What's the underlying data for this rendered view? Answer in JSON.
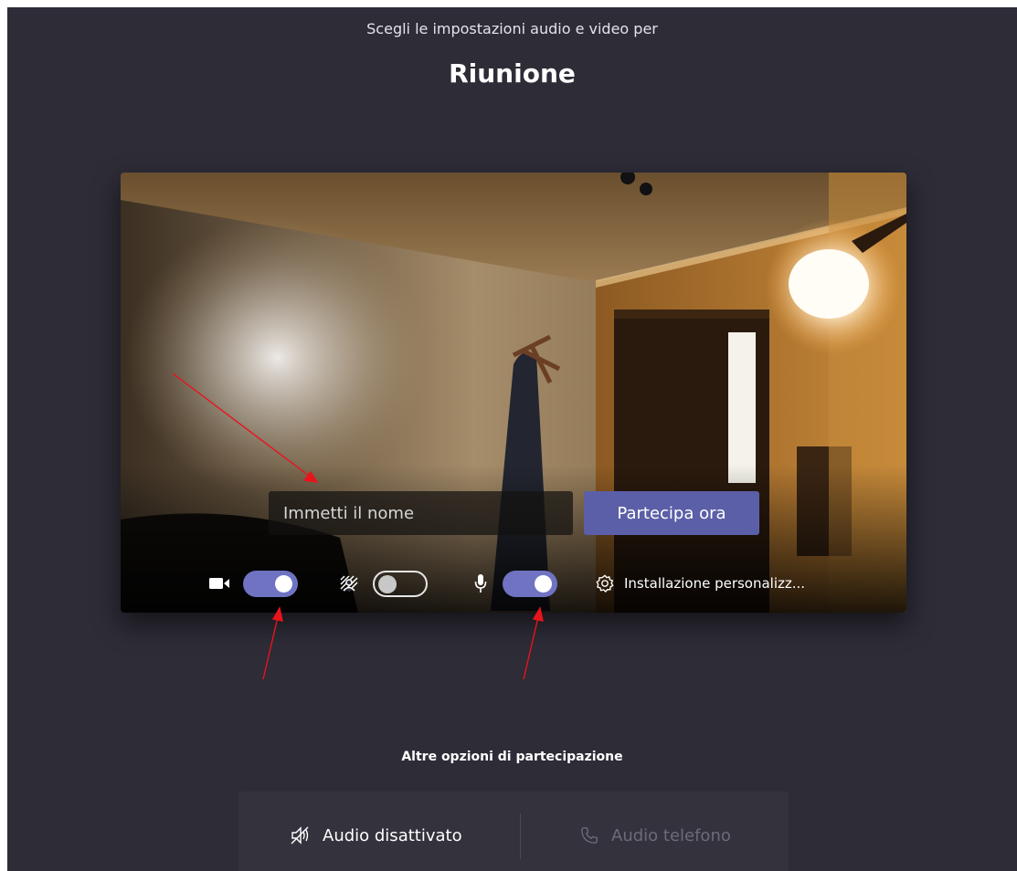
{
  "header": {
    "subtitle": "Scegli le impostazioni audio e video per",
    "title": "Riunione"
  },
  "join_form": {
    "name_placeholder": "Immetti il nome",
    "name_value": "",
    "join_label": "Partecipa ora"
  },
  "controls": {
    "camera": {
      "icon": "video-camera-icon",
      "on": true
    },
    "background_blur": {
      "icon": "background-blur-icon",
      "on": false
    },
    "microphone": {
      "icon": "microphone-icon",
      "on": true
    },
    "custom_setup_label": "Installazione personalizz..."
  },
  "more_options": {
    "heading": "Altre opzioni di partecipazione",
    "audio_off_label": "Audio disattivato",
    "phone_audio_label": "Audio telefono"
  },
  "colors": {
    "background": "#2d2c37",
    "accent": "#5b5fa8",
    "toggle_on": "#6f73c2",
    "annotation_arrow": "#e8141c"
  }
}
